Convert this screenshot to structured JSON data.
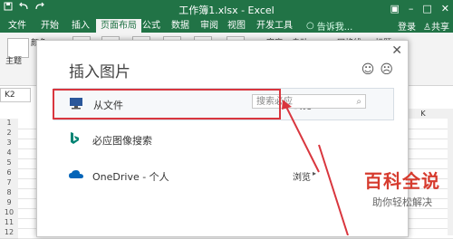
{
  "titlebar": {
    "title": "工作簿1.xlsx - Excel"
  },
  "tabs": {
    "items": [
      "文件",
      "开始",
      "插入",
      "页面布局",
      "公式",
      "数据",
      "审阅",
      "视图",
      "开发工具"
    ],
    "help": "告诉我...",
    "login": "登录",
    "share": "共享"
  },
  "ribbon": {
    "theme": "主题",
    "colors": "颜色",
    "width_label": "宽度:",
    "width_value": "自动",
    "gridlines": "网格线",
    "headings": "标题"
  },
  "namebox": "K2",
  "grid": {
    "rows": [
      "1",
      "2",
      "3",
      "4",
      "5",
      "6",
      "7",
      "8",
      "9",
      "10",
      "11",
      "12"
    ],
    "col_k": "K"
  },
  "dialog": {
    "title": "插入图片",
    "options": [
      {
        "label": "从文件",
        "action": "浏览",
        "icon": "computer-icon"
      },
      {
        "label": "必应图像搜索",
        "placeholder": "搜索必应",
        "icon": "bing-icon"
      },
      {
        "label": "OneDrive - 个人",
        "action": "浏览",
        "icon": "cloud-icon"
      }
    ]
  },
  "watermark": {
    "big": "百科全说",
    "small": "助你轻松解决"
  },
  "colors": {
    "excel_green": "#217346",
    "highlight_red": "#d9363e"
  }
}
